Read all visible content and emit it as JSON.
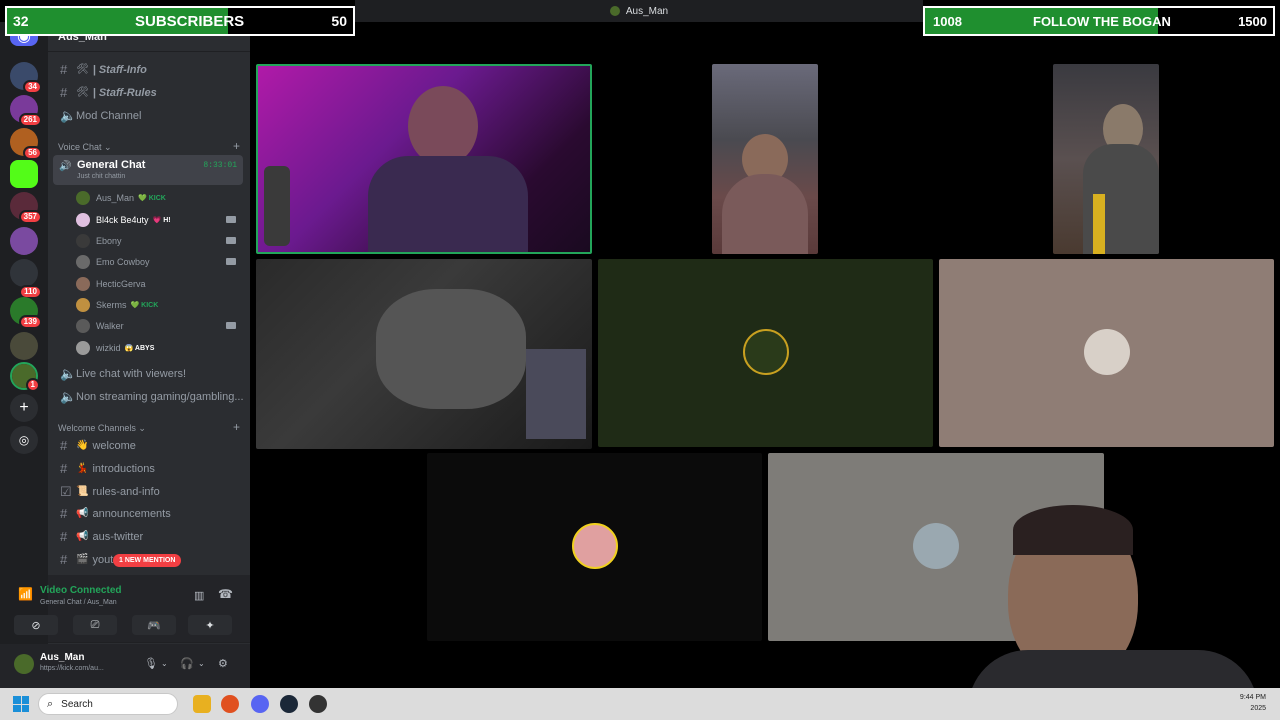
{
  "window": {
    "title": "Aus_Man"
  },
  "overlays": {
    "subs_goal": {
      "current": "32",
      "label": "SUBSCRIBERS",
      "target": "50",
      "progress": 0.64
    },
    "follow_goal": {
      "current": "1008",
      "label": "FOLLOW THE BOGAN",
      "target": "1500",
      "progress": 0.67
    }
  },
  "rail": {
    "servers": [
      {
        "badge": "34"
      },
      {
        "badge": "261"
      },
      {
        "badge": "56"
      },
      {
        "badge": ""
      },
      {
        "badge": "357"
      },
      {
        "badge": ""
      },
      {
        "badge": "110"
      },
      {
        "badge": "139"
      },
      {
        "badge": ""
      },
      {
        "badge": "1"
      }
    ]
  },
  "server": {
    "name": "Aus_Man"
  },
  "channels_top": [
    {
      "icon": "🛠",
      "label": "| Staff-Info"
    },
    {
      "icon": "🛠",
      "label": "| Staff-Rules"
    },
    {
      "icon": "",
      "label": "Mod Channel"
    }
  ],
  "voice_category": {
    "label": "Voice Chat"
  },
  "voice_channel": {
    "name": "General Chat",
    "status": "Just chit chattin",
    "timer": "8:33:01"
  },
  "voice_users": [
    {
      "name": "Aus_Man",
      "tag": "💚 KICK",
      "cam": false
    },
    {
      "name": "Bl4ck Be4uty",
      "tag": "💗 H!",
      "cam": true
    },
    {
      "name": "Ebony",
      "tag": "",
      "cam": true
    },
    {
      "name": "Emo Cowboy",
      "tag": "",
      "cam": true
    },
    {
      "name": "HecticGerva",
      "tag": "",
      "cam": false
    },
    {
      "name": "Skerms",
      "tag": "💚 KICK",
      "cam": false
    },
    {
      "name": "Walker",
      "tag": "",
      "cam": true
    },
    {
      "name": "wizkid",
      "tag": "😱 ABYS",
      "cam": false
    }
  ],
  "voice_extra": [
    {
      "label": "Live chat with viewers!"
    },
    {
      "label": "Non streaming gaming/gambling..."
    }
  ],
  "welcome_category": {
    "label": "Welcome Channels"
  },
  "welcome_channels": [
    {
      "icon": "👋",
      "label": "welcome"
    },
    {
      "icon": "💃",
      "label": "introductions"
    },
    {
      "icon": "📜",
      "label": "rules-and-info"
    },
    {
      "icon": "📢",
      "label": "announcements"
    },
    {
      "icon": "📢",
      "label": "aus-twitter"
    },
    {
      "icon": "🎬",
      "label": "yout"
    }
  ],
  "mention_pill": "1 NEW MENTION",
  "voice_status": {
    "title": "Video Connected",
    "subtitle": "General Chat / Aus_Man"
  },
  "me": {
    "name": "Aus_Man",
    "status": "https://kick.com/au..."
  },
  "taskbar": {
    "search_placeholder": "Search",
    "time": "9:44 PM",
    "date": "2025"
  },
  "colors": {
    "accent_green": "#23a55a",
    "goal_fill": "#1f8f2f",
    "mention_red": "#f23f43"
  }
}
